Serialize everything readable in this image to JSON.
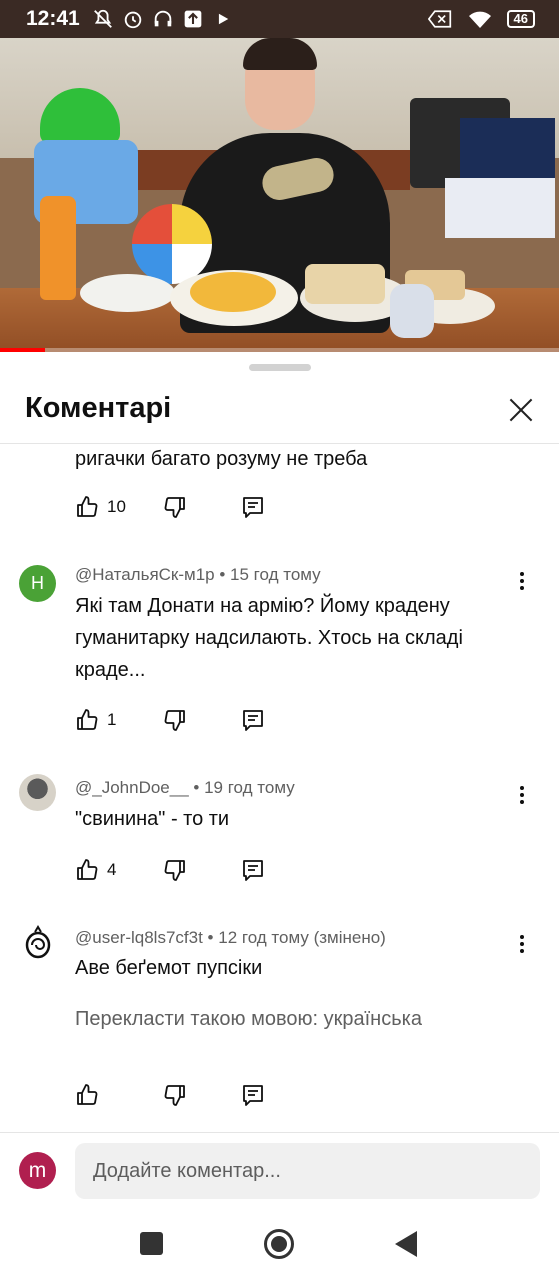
{
  "status_bar": {
    "time": "12:41",
    "battery": "46",
    "left_icons": [
      "mute-icon",
      "alarm-icon",
      "headset-icon",
      "upload-icon",
      "play-icon"
    ],
    "right_icons": [
      "close-box-icon",
      "wifi-icon",
      "battery-icon"
    ]
  },
  "video": {
    "progress_fraction": 0.08,
    "accent": "#ff0000"
  },
  "comments_panel": {
    "title": "Коментарі",
    "comments": [
      {
        "text": "ригачки багато розуму не треба",
        "likes": "10"
      },
      {
        "avatar_letter": "Н",
        "avatar_color": "#4aa236",
        "author": "@НатальяСк-м1р",
        "time": "15 год тому",
        "text_lines": [
          "Які там Донати на армію? Йому крадену",
          "гуманитарку надсилають. Хтось на складі",
          "краде..."
        ],
        "likes": "1"
      },
      {
        "author": "@_JohnDoe__",
        "time": "19 год тому",
        "text": "\"свинина\" - то ти",
        "likes": "4"
      },
      {
        "author": "@user-lq8ls7cf3t",
        "time": "12 год тому (змінено)",
        "text": "Аве беґемот пупсіки",
        "translate": "Перекласти такою мовою: українська",
        "likes": ""
      }
    ],
    "separator": "•"
  },
  "add_comment": {
    "avatar_letter": "m",
    "avatar_color": "#b01f4f",
    "placeholder": "Додайте коментар..."
  }
}
